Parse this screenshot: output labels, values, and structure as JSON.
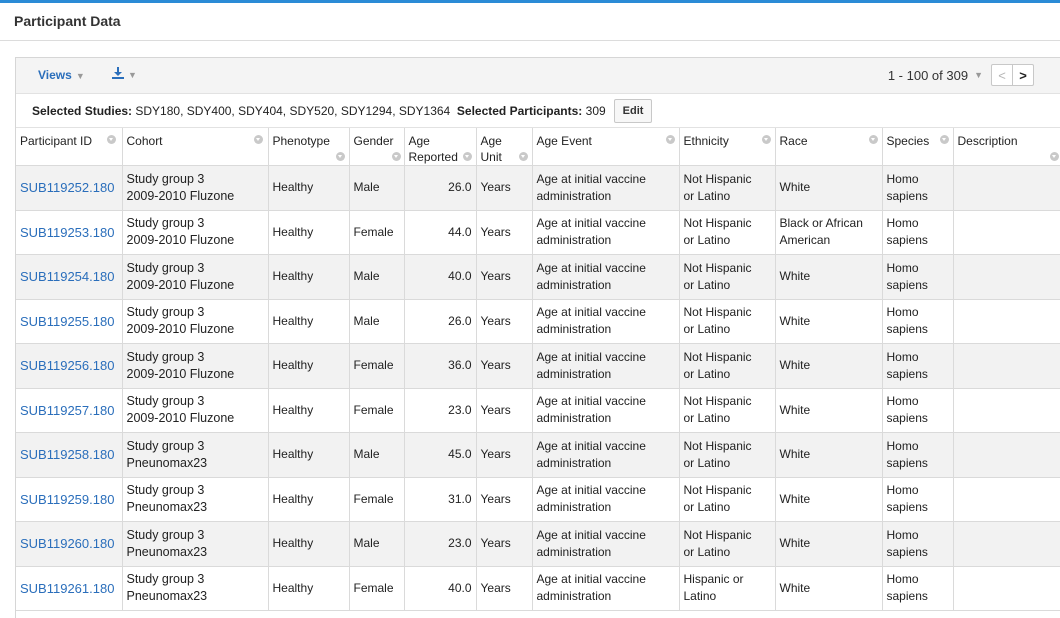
{
  "panel": {
    "title": "Participant Data"
  },
  "toolbar": {
    "views_label": "Views",
    "export_icon": "download-icon",
    "paging_text": "1 - 100 of 309",
    "prev_glyph": "<",
    "next_glyph": ">"
  },
  "selection": {
    "studies_label": "Selected Studies:",
    "studies_value": "SDY180, SDY400, SDY404, SDY520, SDY1294, SDY1364",
    "participants_label": "Selected Participants:",
    "participants_value": "309",
    "edit_label": "Edit"
  },
  "colors": {
    "accent": "#2a8bd6",
    "link": "#2a6ebb",
    "row_alt": "#f2f2f2"
  },
  "table": {
    "columns": [
      {
        "key": "participant_id",
        "line1": "Participant ID",
        "line2": ""
      },
      {
        "key": "cohort",
        "line1": "Cohort",
        "line2": ""
      },
      {
        "key": "phenotype",
        "line1": "Phenotype",
        "line2": ""
      },
      {
        "key": "gender",
        "line1": "Gender",
        "line2": ""
      },
      {
        "key": "age_reported",
        "line1": "Age",
        "line2": "Reported"
      },
      {
        "key": "age_unit",
        "line1": "Age",
        "line2": "Unit"
      },
      {
        "key": "age_event",
        "line1": "Age Event",
        "line2": ""
      },
      {
        "key": "ethnicity",
        "line1": "Ethnicity",
        "line2": ""
      },
      {
        "key": "race",
        "line1": "Race",
        "line2": ""
      },
      {
        "key": "species",
        "line1": "Species",
        "line2": ""
      },
      {
        "key": "description",
        "line1": "Description",
        "line2": ""
      }
    ],
    "rows": [
      {
        "participant_id": "SUB119252.180",
        "cohort_1": "Study group 3",
        "cohort_2": "2009-2010 Fluzone",
        "phenotype": "Healthy",
        "gender": "Male",
        "age_reported": "26.0",
        "age_unit": "Years",
        "age_event_1": "Age at initial vaccine",
        "age_event_2": "administration",
        "ethnicity_1": "Not Hispanic",
        "ethnicity_2": "or Latino",
        "race_1": "White",
        "race_2": "",
        "species_1": "Homo",
        "species_2": "sapiens",
        "description": ""
      },
      {
        "participant_id": "SUB119253.180",
        "cohort_1": "Study group 3",
        "cohort_2": "2009-2010 Fluzone",
        "phenotype": "Healthy",
        "gender": "Female",
        "age_reported": "44.0",
        "age_unit": "Years",
        "age_event_1": "Age at initial vaccine",
        "age_event_2": "administration",
        "ethnicity_1": "Not Hispanic",
        "ethnicity_2": "or Latino",
        "race_1": "Black or African",
        "race_2": "American",
        "species_1": "Homo",
        "species_2": "sapiens",
        "description": ""
      },
      {
        "participant_id": "SUB119254.180",
        "cohort_1": "Study group 3",
        "cohort_2": "2009-2010 Fluzone",
        "phenotype": "Healthy",
        "gender": "Male",
        "age_reported": "40.0",
        "age_unit": "Years",
        "age_event_1": "Age at initial vaccine",
        "age_event_2": "administration",
        "ethnicity_1": "Not Hispanic",
        "ethnicity_2": "or Latino",
        "race_1": "White",
        "race_2": "",
        "species_1": "Homo",
        "species_2": "sapiens",
        "description": ""
      },
      {
        "participant_id": "SUB119255.180",
        "cohort_1": "Study group 3",
        "cohort_2": "2009-2010 Fluzone",
        "phenotype": "Healthy",
        "gender": "Male",
        "age_reported": "26.0",
        "age_unit": "Years",
        "age_event_1": "Age at initial vaccine",
        "age_event_2": "administration",
        "ethnicity_1": "Not Hispanic",
        "ethnicity_2": "or Latino",
        "race_1": "White",
        "race_2": "",
        "species_1": "Homo",
        "species_2": "sapiens",
        "description": ""
      },
      {
        "participant_id": "SUB119256.180",
        "cohort_1": "Study group 3",
        "cohort_2": "2009-2010 Fluzone",
        "phenotype": "Healthy",
        "gender": "Female",
        "age_reported": "36.0",
        "age_unit": "Years",
        "age_event_1": "Age at initial vaccine",
        "age_event_2": "administration",
        "ethnicity_1": "Not Hispanic",
        "ethnicity_2": "or Latino",
        "race_1": "White",
        "race_2": "",
        "species_1": "Homo",
        "species_2": "sapiens",
        "description": ""
      },
      {
        "participant_id": "SUB119257.180",
        "cohort_1": "Study group 3",
        "cohort_2": "2009-2010 Fluzone",
        "phenotype": "Healthy",
        "gender": "Female",
        "age_reported": "23.0",
        "age_unit": "Years",
        "age_event_1": "Age at initial vaccine",
        "age_event_2": "administration",
        "ethnicity_1": "Not Hispanic",
        "ethnicity_2": "or Latino",
        "race_1": "White",
        "race_2": "",
        "species_1": "Homo",
        "species_2": "sapiens",
        "description": ""
      },
      {
        "participant_id": "SUB119258.180",
        "cohort_1": "Study group 3",
        "cohort_2": "Pneunomax23",
        "phenotype": "Healthy",
        "gender": "Male",
        "age_reported": "45.0",
        "age_unit": "Years",
        "age_event_1": "Age at initial vaccine",
        "age_event_2": "administration",
        "ethnicity_1": "Not Hispanic",
        "ethnicity_2": "or Latino",
        "race_1": "White",
        "race_2": "",
        "species_1": "Homo",
        "species_2": "sapiens",
        "description": ""
      },
      {
        "participant_id": "SUB119259.180",
        "cohort_1": "Study group 3",
        "cohort_2": "Pneunomax23",
        "phenotype": "Healthy",
        "gender": "Female",
        "age_reported": "31.0",
        "age_unit": "Years",
        "age_event_1": "Age at initial vaccine",
        "age_event_2": "administration",
        "ethnicity_1": "Not Hispanic",
        "ethnicity_2": "or Latino",
        "race_1": "White",
        "race_2": "",
        "species_1": "Homo",
        "species_2": "sapiens",
        "description": ""
      },
      {
        "participant_id": "SUB119260.180",
        "cohort_1": "Study group 3",
        "cohort_2": "Pneunomax23",
        "phenotype": "Healthy",
        "gender": "Male",
        "age_reported": "23.0",
        "age_unit": "Years",
        "age_event_1": "Age at initial vaccine",
        "age_event_2": "administration",
        "ethnicity_1": "Not Hispanic",
        "ethnicity_2": "or Latino",
        "race_1": "White",
        "race_2": "",
        "species_1": "Homo",
        "species_2": "sapiens",
        "description": ""
      },
      {
        "participant_id": "SUB119261.180",
        "cohort_1": "Study group 3",
        "cohort_2": "Pneunomax23",
        "phenotype": "Healthy",
        "gender": "Female",
        "age_reported": "40.0",
        "age_unit": "Years",
        "age_event_1": "Age at initial vaccine",
        "age_event_2": "administration",
        "ethnicity_1": "Hispanic or",
        "ethnicity_2": "Latino",
        "race_1": "White",
        "race_2": "",
        "species_1": "Homo",
        "species_2": "sapiens",
        "description": ""
      }
    ]
  }
}
